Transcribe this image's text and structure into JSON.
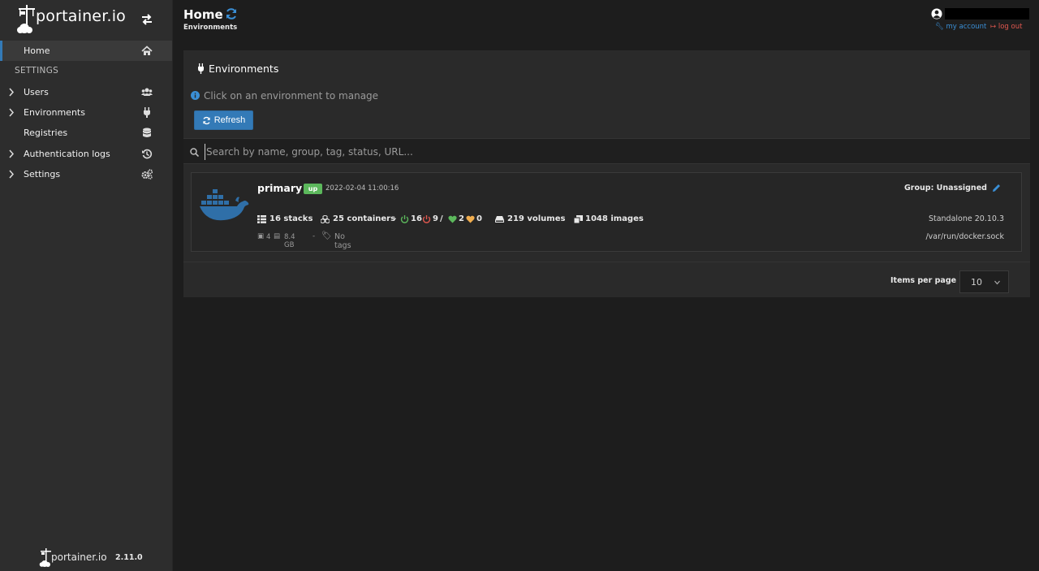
{
  "brand": {
    "name": "portainer.io",
    "version": "2.11.0"
  },
  "sidebar": {
    "home_label": "Home",
    "section_label": "SETTINGS",
    "items": [
      {
        "label": "Users",
        "icon": "users-icon",
        "expandable": true
      },
      {
        "label": "Environments",
        "icon": "plug-icon",
        "expandable": true
      },
      {
        "label": "Registries",
        "icon": "database-icon",
        "expandable": false
      },
      {
        "label": "Authentication logs",
        "icon": "history-icon",
        "expandable": true
      },
      {
        "label": "Settings",
        "icon": "cogs-icon",
        "expandable": true
      }
    ]
  },
  "header": {
    "title": "Home",
    "breadcrumb": "Environments",
    "my_account": "my account",
    "log_out": "log out"
  },
  "panel": {
    "title": "Environments",
    "info": "Click on an environment to manage",
    "refresh_label": "Refresh",
    "search_placeholder": "Search by name, group, tag, status, URL..."
  },
  "environment": {
    "name": "primary",
    "status": "up",
    "timestamp": "2022-02-04 11:00:16",
    "group": "Group: Unassigned",
    "stacks": "16 stacks",
    "containers": "25 containers",
    "dash": "-",
    "running": "16",
    "stopped": "9",
    "slash": "/",
    "healthy": "2",
    "unhealthy": "0",
    "volumes": "219 volumes",
    "images": "1048 images",
    "cpu": "4",
    "memory": "8.4 GB",
    "sep": "-",
    "tags": "No tags",
    "type_version": "Standalone 20.10.3",
    "socket": "/var/run/docker.sock"
  },
  "pagination": {
    "label": "Items per page",
    "value": "10"
  },
  "colors": {
    "accent": "#337ab7",
    "success": "#5cb85c",
    "danger": "#e0574f",
    "warning": "#f0ad4e"
  }
}
